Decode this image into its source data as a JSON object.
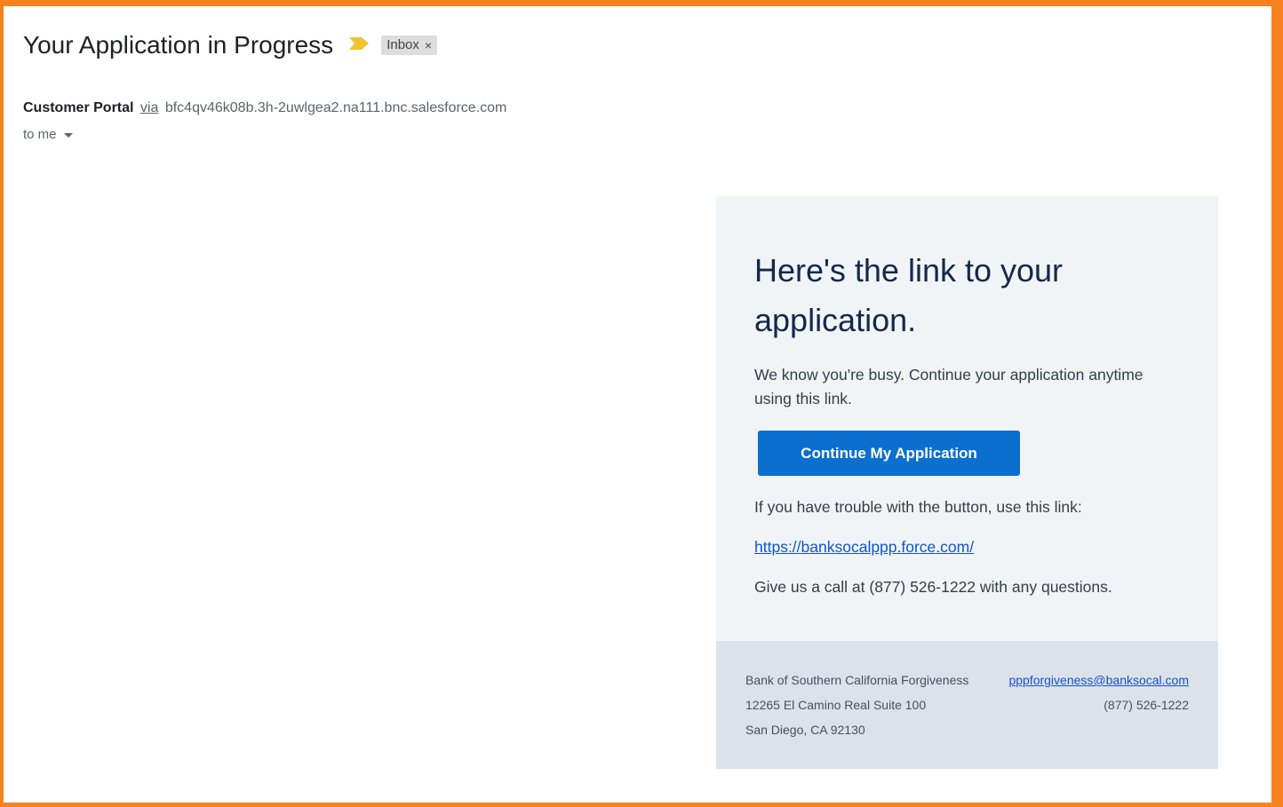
{
  "email": {
    "subject": "Your Application in Progress",
    "label_chip": "Inbox",
    "label_remove_glyph": "×",
    "sender_name": "Customer Portal",
    "via_text": "via",
    "sender_domain": "bfc4qv46k08b.3h-2uwlgea2.na111.bnc.salesforce.com",
    "recipient_text": "to me",
    "importance_icon": "importance-marker-icon",
    "importance_color": "#f2c231"
  },
  "message": {
    "heading": "Here's the link to your application.",
    "intro": "We know you're busy. Continue your application anytime using this link.",
    "button_label": "Continue My Application",
    "trouble_text": "If you have trouble with the button, use this link:",
    "link_text": "https://banksocalppp.force.com/",
    "call_text": "Give us a call at (877) 526-1222 with any questions."
  },
  "footer": {
    "org_name": "Bank of Southern California Forgiveness",
    "email": "pppforgiveness@banksocal.com",
    "street": "12265 El Camino Real Suite 100",
    "phone": "(877) 526-1222",
    "city": "San Diego, CA 92130"
  },
  "colors": {
    "frame_border": "#f5821f",
    "button_bg": "#0b6fd0",
    "card_bg": "#f1f4f7",
    "footer_bg": "#dde1ea",
    "heading_color": "#14284b",
    "link_color": "#1155cc"
  }
}
